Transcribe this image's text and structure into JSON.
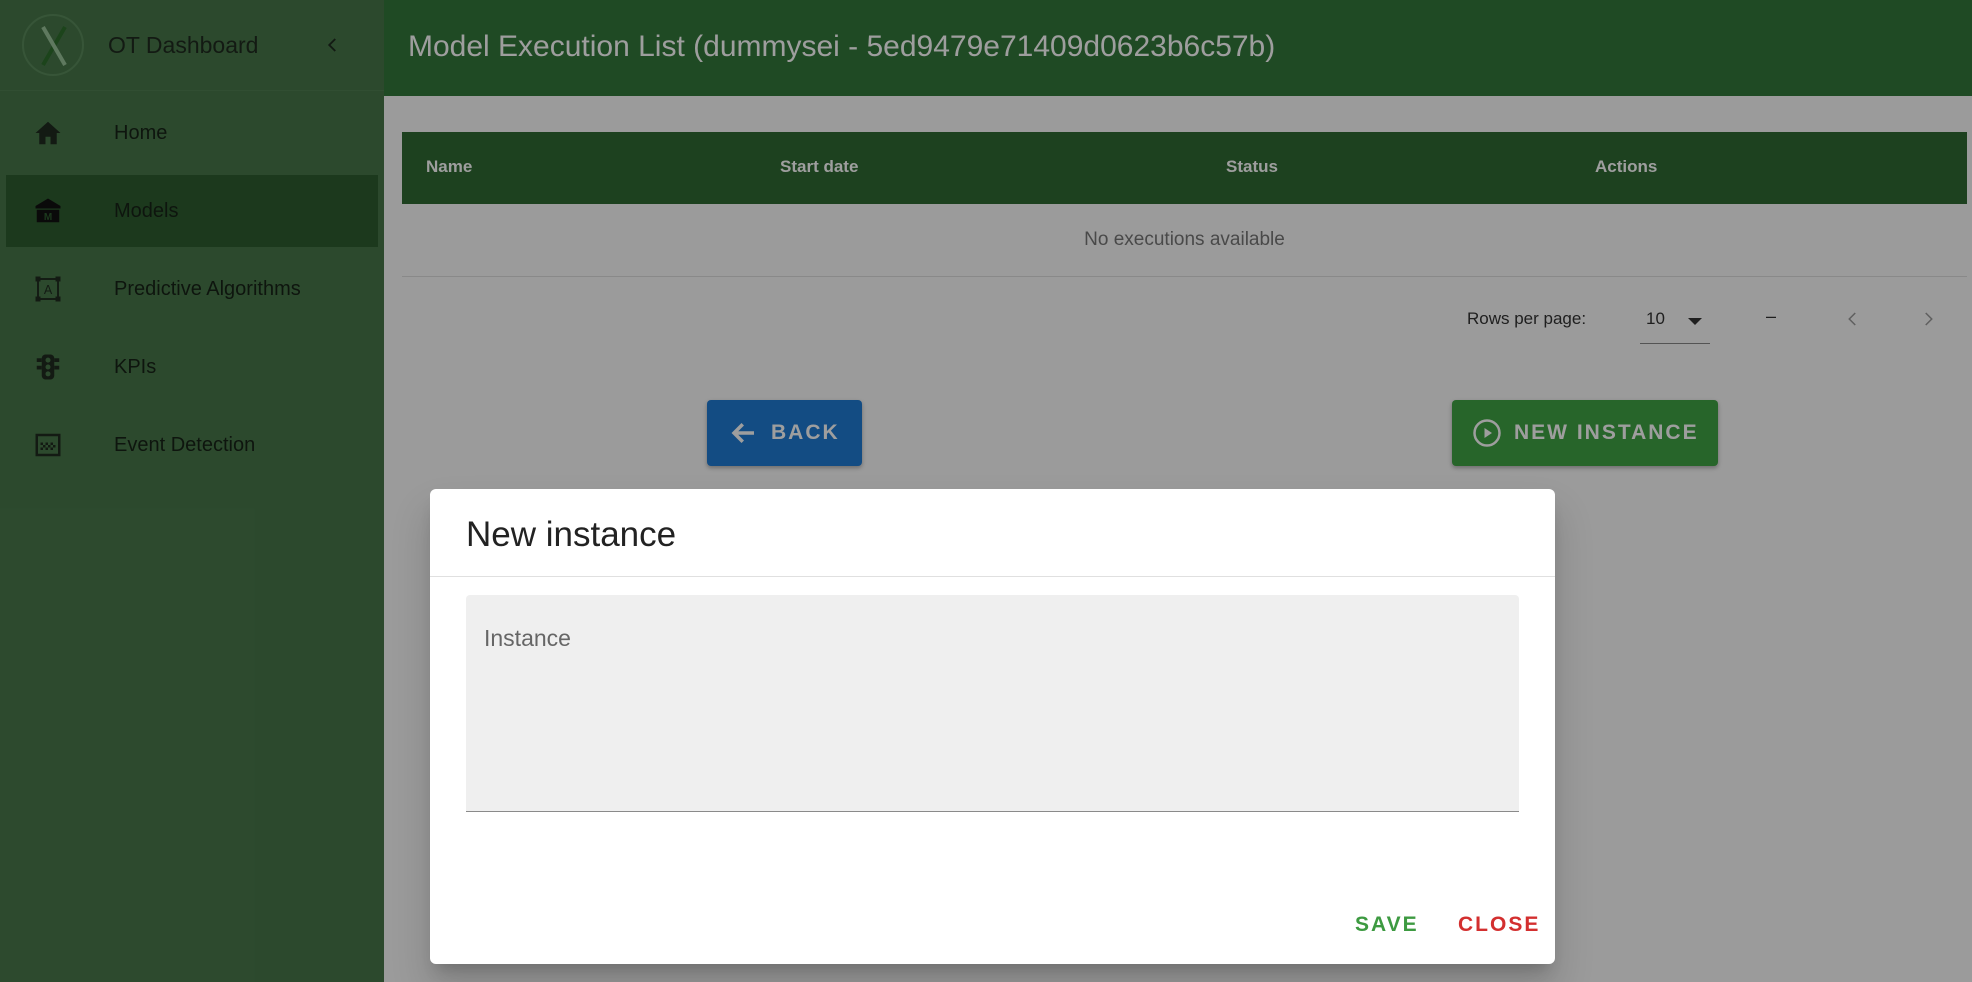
{
  "sidebar": {
    "app_title": "OT Dashboard",
    "items": [
      {
        "label": "Home",
        "icon": "home-icon"
      },
      {
        "label": "Models",
        "icon": "model-building-icon"
      },
      {
        "label": "Predictive Algorithms",
        "icon": "algorithm-icon"
      },
      {
        "label": "KPIs",
        "icon": "traffic-light-icon"
      },
      {
        "label": "Event Detection",
        "icon": "event-grid-icon"
      }
    ],
    "active_item": "Models"
  },
  "header": {
    "title": "Model Execution List (dummysei - 5ed9479e71409d0623b6c57b)"
  },
  "table": {
    "columns": [
      "Name",
      "Start date",
      "Status",
      "Actions"
    ],
    "empty_text": "No executions available",
    "pagination": {
      "rows_label": "Rows per page:",
      "rows_value": "10",
      "range": "–"
    }
  },
  "buttons": {
    "back": "BACK",
    "new_instance": "NEW INSTANCE"
  },
  "dialog": {
    "title": "New instance",
    "field_label": "Instance",
    "save": "SAVE",
    "close": "CLOSE"
  },
  "colors": {
    "sidebar": "#48774a",
    "sidebar_active": "#2e5d30",
    "header": "#33783a",
    "table_header": "#2f6a33",
    "back_button": "#1f7bd4",
    "new_button": "#40a344",
    "save": "#3d9a41",
    "close": "#d32f2f"
  }
}
